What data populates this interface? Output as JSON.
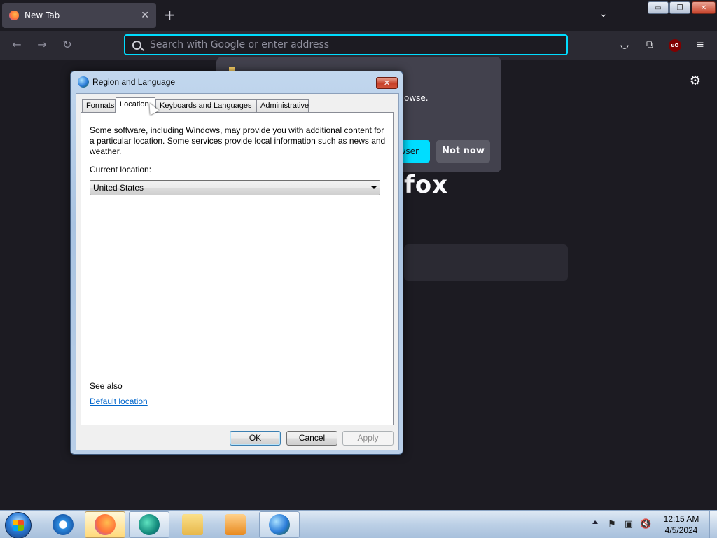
{
  "browser": {
    "tab_title": "New Tab",
    "tab_close_glyph": "✕",
    "new_tab_glyph": "+",
    "list_all_tabs_glyph": "⌄",
    "back_glyph": "←",
    "forward_glyph": "→",
    "reload_glyph": "↻",
    "url_placeholder": "Search with Google or enter address",
    "pocket_glyph": "◡",
    "extensions_glyph": "⧉",
    "ublock_label": "uO",
    "menu_glyph": "≡",
    "settings_glyph": "⚙"
  },
  "window_controls": {
    "minimize": "▭",
    "maximize": "❐",
    "close": "✕"
  },
  "firefox_popup": {
    "message_fragment": "owse.",
    "primary_button_fragment": "wser",
    "secondary_button": "Not now",
    "wordmark_fragment": "fox"
  },
  "dialog": {
    "title": "Region and Language",
    "close_glyph": "✕",
    "tabs": [
      "Formats",
      "Location",
      "Keyboards and Languages",
      "Administrative"
    ],
    "active_tab": "Location",
    "description": "Some software, including Windows, may provide you with additional content for a particular location. Some services provide local information such as news and weather.",
    "current_location_label": "Current location:",
    "current_location_value": "United States",
    "see_also": "See also",
    "default_location_link": "Default location",
    "buttons": {
      "ok": "OK",
      "cancel": "Cancel",
      "apply": "Apply"
    }
  },
  "taskbar": {
    "items": [
      "internet-explorer",
      "firefox",
      "edge",
      "windows-explorer",
      "media-player",
      "region-and-language"
    ],
    "active_item": "firefox",
    "tray": {
      "flag_glyph": "⚑",
      "network_glyph": "▣",
      "volume_glyph": "🔇"
    },
    "clock_time": "12:15 AM",
    "clock_date": "4/5/2024"
  },
  "colors": {
    "accent": "#00ddff",
    "browser_bg": "#1c1b22",
    "toolbar_bg": "#2b2a33",
    "link": "#0066cc"
  }
}
